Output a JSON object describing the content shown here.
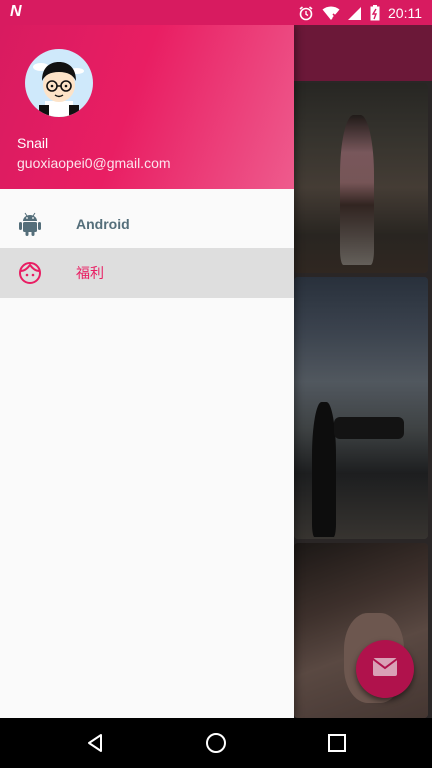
{
  "status_bar": {
    "time": "20:11",
    "logo": "N",
    "icons": [
      "alarm-icon",
      "wifi-icon",
      "signal-icon",
      "battery-icon"
    ]
  },
  "drawer": {
    "user": {
      "name": "Snail",
      "email": "guoxiaopei0@gmail.com"
    },
    "items": [
      {
        "label": "Android",
        "icon": "android-icon",
        "selected": false
      },
      {
        "label": "福利",
        "icon": "face-icon",
        "selected": true
      }
    ]
  },
  "fab": {
    "icon": "mail-icon"
  },
  "navigation": {
    "buttons": [
      "back-button",
      "home-button",
      "recents-button"
    ]
  },
  "colors": {
    "accent": "#e91e63",
    "primary_dark": "#d81b60",
    "android_item": "#546e7a",
    "selected_bg": "#dedede"
  }
}
